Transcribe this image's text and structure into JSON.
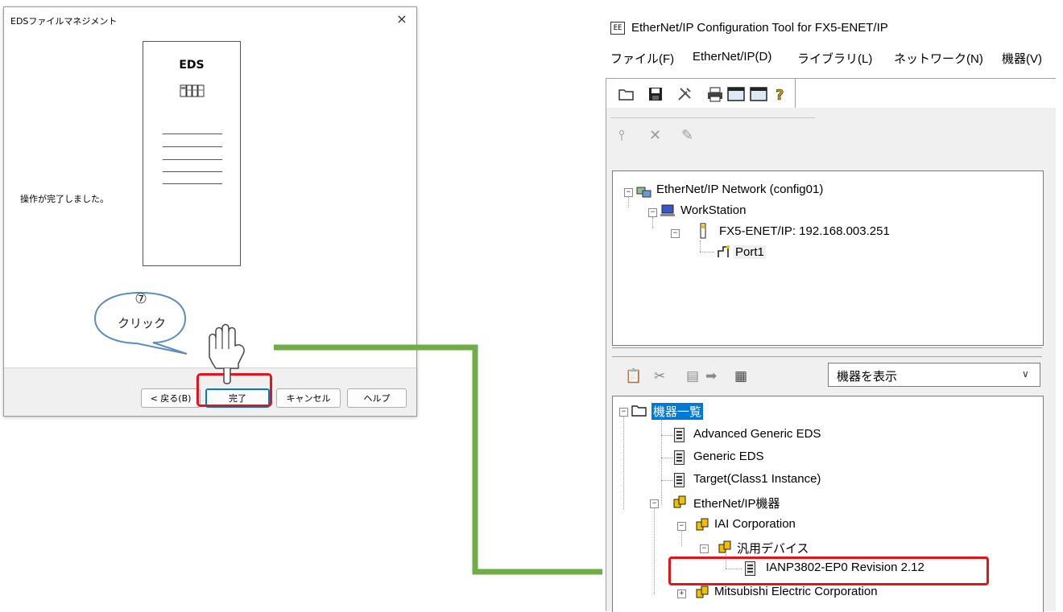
{
  "eds_dialog": {
    "title": "EDSファイルマネジメント",
    "close_glyph": "×",
    "document_label": "EDS",
    "message": "操作が完了しました。",
    "buttons": {
      "back": "< 戻る(B)",
      "finish": "完了",
      "cancel": "キャンセル",
      "help": "ヘルプ"
    }
  },
  "callout": {
    "step_number": "⑦",
    "text": "クリック"
  },
  "config_tool": {
    "icon_label": "EE",
    "title": "EtherNet/IP Configuration Tool for FX5-ENET/IP",
    "menu": [
      "ファイル(F)",
      "EtherNet/IP(D)",
      "ライブラリ(L)",
      "ネットワーク(N)",
      "機器(V)"
    ],
    "network_tree": {
      "network": "EtherNet/IP Network (config01)",
      "workstation": "WorkStation",
      "module": "FX5-ENET/IP: 192.168.003.251",
      "port": "Port1"
    },
    "device_filter": {
      "selected": "機器を表示",
      "arrow": "∨"
    },
    "device_tree": {
      "root": "機器一覧",
      "items": {
        "advanced_generic": "Advanced Generic EDS",
        "generic": "Generic EDS",
        "target": "Target(Class1 Instance)",
        "ethernet_ip": "EtherNet/IP機器",
        "iai": "IAI Corporation",
        "general_device": "汎用デバイス",
        "ianp": "IANP3802-EP0 Revision 2.12",
        "mitsubishi": "Mitsubishi Electric Corporation"
      }
    }
  },
  "colors": {
    "highlight_red": "#e8131a",
    "arrow_green": "#70ad47",
    "callout_border": "#5b8dbd",
    "selection_blue": "#0078d7"
  }
}
